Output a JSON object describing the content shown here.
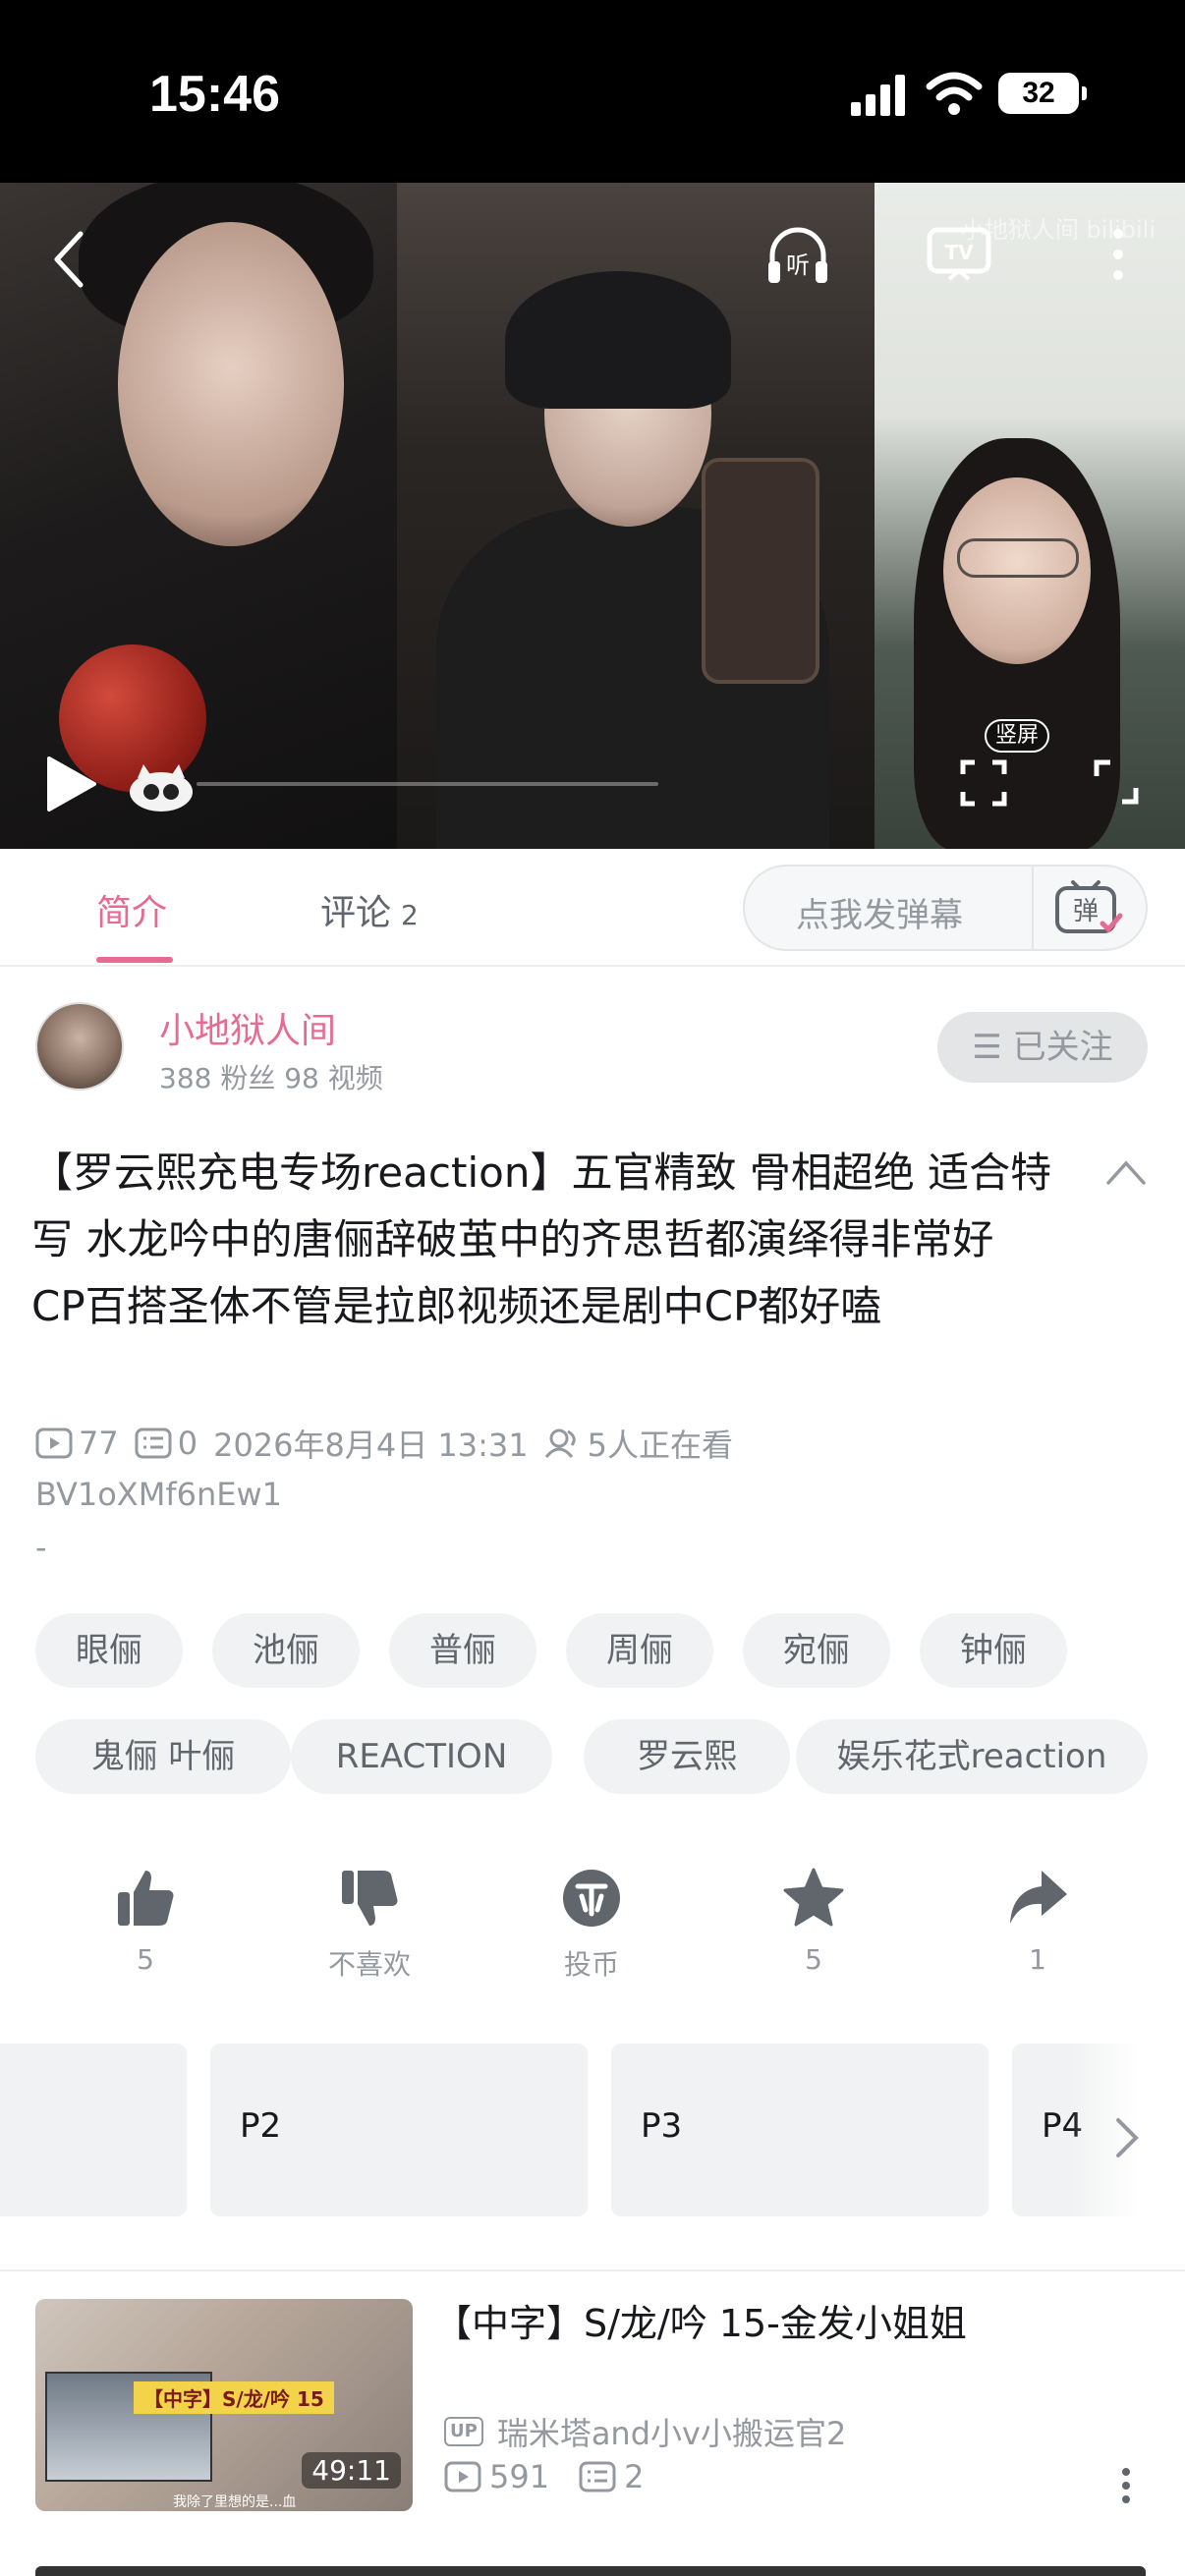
{
  "status_bar": {
    "time": "15:46",
    "battery": "32"
  },
  "video": {
    "vertical_badge": "竖屏",
    "watermark": "小地狱人间 bilibili"
  },
  "tabs": {
    "intro": "简介",
    "comments": "评论",
    "comments_count": "2"
  },
  "danmaku": {
    "placeholder": "点我发弹幕"
  },
  "author": {
    "name": "小地狱人间",
    "stats": "388 粉丝   98 视频",
    "follow_label": "☰ 已关注"
  },
  "video_info": {
    "title": "【罗云熙充电专场reaction】五官精致 骨相超绝 适合特写 水龙吟中的唐俪辞破茧中的齐思哲都演绎得非常好  CP百搭圣体不管是拉郎视频还是剧中CP都好嗑",
    "views": "77",
    "danmaku_count": "0",
    "date": "2026年8月4日 13:31",
    "watching": "5人正在看",
    "bvid": "BV1oXMf6nEw1",
    "desc": "-"
  },
  "tags": [
    "眼俪",
    "池俪",
    "普俪",
    "周俪",
    "宛俪",
    "钟俪",
    "鬼俪 叶俪",
    "REACTION",
    "罗云熙",
    "娱乐花式reaction"
  ],
  "actions": {
    "like": "5",
    "dislike": "不喜欢",
    "coin": "投币",
    "favorite": "5",
    "share": "1"
  },
  "parts": [
    "P2",
    "P3",
    "P4"
  ],
  "recommend": {
    "title": "【中字】S/龙/吟 15-金发小姐姐",
    "duration": "49:11",
    "thumb_badge": "【中字】S/龙/吟 15",
    "thumb_sub": "我除了里想的是...血",
    "uploader": "瑞米塔and小v小搬运官2",
    "views": "591",
    "danmaku": "2"
  },
  "colors": {
    "accent": "#e76b91",
    "muted": "#9499a0",
    "text": "#18191c"
  }
}
